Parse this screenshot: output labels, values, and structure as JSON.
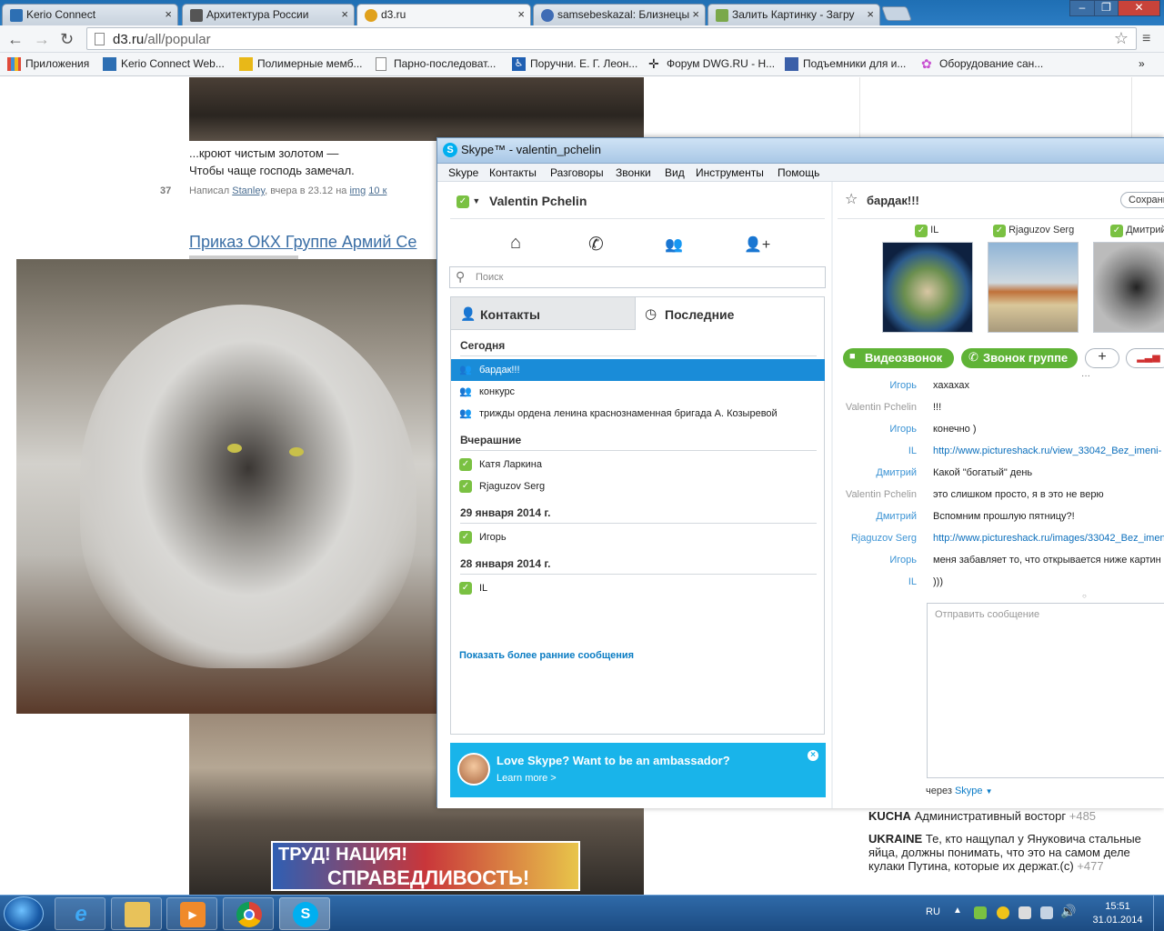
{
  "browser": {
    "tabs": [
      {
        "label": "Kerio Connect",
        "color": "#2d6fb3"
      },
      {
        "label": "Архитектура России",
        "color": "#555555"
      },
      {
        "label": "d3.ru",
        "color": "#e0a11c"
      },
      {
        "label": "samsebeskazal: Близнецы",
        "color": "#3f6cb5"
      },
      {
        "label": "Залить Картинку - Загру",
        "color": "#7aa84a"
      }
    ],
    "url_host": "d3.ru",
    "url_path": "/all/popular",
    "bookmarks": [
      {
        "label": "Приложения",
        "color": "#e04a3a"
      },
      {
        "label": "Kerio Connect Web...",
        "color": "#2d6fb3"
      },
      {
        "label": "Полимерные мемб...",
        "color": "#e8b818"
      },
      {
        "label": "Парно-последоват...",
        "color": "#dddddd"
      },
      {
        "label": "Поручни. Е. Г. Леон...",
        "color": "#1f5fb2"
      },
      {
        "label": "Форум DWG.RU - Н...",
        "color": "#333333"
      },
      {
        "label": "Подъемники для и...",
        "color": "#3a5fa8"
      },
      {
        "label": "Оборудование сан...",
        "color": "#c84fd1"
      }
    ]
  },
  "page": {
    "poem_line1": "...кроют чистым золотом —",
    "poem_line2": "Чтобы чаще господь замечал.",
    "rating": "37",
    "byline_prefix": "Написал",
    "byline_author": "Stanley",
    "byline_time": ", вчера в 23.12 на",
    "byline_site": "img",
    "byline_comments": "10 к",
    "post_title": "Приказ ОКХ Группе Армий Се",
    "banner_text_1": "ТРУД! НАЦИЯ!",
    "banner_text_2": "СПРАВЕДЛИВОСТЬ!",
    "sidebar": [
      {
        "site": "KUCHA",
        "text": "Административный восторг",
        "count": "+485"
      },
      {
        "site": "UKRAINE",
        "text": "Те, кто нащупал у Януковича стальные яйца, должны понимать, что это на самом деле кулаки Путина, которые их держат.(с)",
        "count": "+477"
      }
    ]
  },
  "skype": {
    "title": "Skype™ - valentin_pchelin",
    "menu": [
      "Skype",
      "Контакты",
      "Разговоры",
      "Звонки",
      "Вид",
      "Инструменты",
      "Помощь"
    ],
    "profile_name": "Valentin Pchelin",
    "search_placeholder": "Поиск",
    "tab_contacts": "Контакты",
    "tab_recent": "Последние",
    "groups": [
      {
        "heading": "Сегодня",
        "items": [
          {
            "label": "бардак!!!",
            "kind": "group",
            "selected": true
          },
          {
            "label": "конкурс",
            "kind": "group",
            "selected": false
          },
          {
            "label": "трижды ордена ленина краснознаменная бригада А. Козыревой",
            "kind": "group",
            "selected": false
          }
        ]
      },
      {
        "heading": "Вчерашние",
        "items": [
          {
            "label": "Катя Ларкина",
            "kind": "contact",
            "selected": false
          },
          {
            "label": "Rjaguzov Serg",
            "kind": "contact",
            "selected": false
          }
        ]
      },
      {
        "heading": "29 января 2014 г.",
        "items": [
          {
            "label": "Игорь",
            "kind": "contact",
            "selected": false
          }
        ]
      },
      {
        "heading": "28 января 2014 г.",
        "items": [
          {
            "label": "IL",
            "kind": "contact",
            "selected": false
          }
        ]
      }
    ],
    "show_earlier": "Показать более ранние сообщения",
    "ambassador_title": "Love Skype? Want to be an ambassador?",
    "ambassador_link": "Learn more >",
    "chat_title": "бардак!!!",
    "save_label": "Сохрани",
    "participants": [
      "IL",
      "Rjaguzov Serg",
      "Дмитрий"
    ],
    "video_call": "Видеозвонок",
    "group_call": "Звонок группе",
    "add_symbol": "+",
    "more_dots": "···",
    "messages": [
      {
        "author": "Игорь",
        "text": "хахахах",
        "me": false,
        "link": false
      },
      {
        "author": "Valentin Pchelin",
        "text": "!!!",
        "me": true,
        "link": false
      },
      {
        "author": "Игорь",
        "text": "конечно )",
        "me": false,
        "link": false
      },
      {
        "author": "IL",
        "text": "http://www.pictureshack.ru/view_33042_Bez_imeni-",
        "me": false,
        "link": true
      },
      {
        "author": "Дмитрий",
        "text": "Какой \"богатый\" день",
        "me": false,
        "link": false
      },
      {
        "author": "Valentin Pchelin",
        "text": "это слишком просто, я в это не верю",
        "me": true,
        "link": false
      },
      {
        "author": "Дмитрий",
        "text": "Вспомним прошлую пятницу?!",
        "me": false,
        "link": false
      },
      {
        "author": "Rjaguzov Serg",
        "text": "http://www.pictureshack.ru/images/33042_Bez_imen",
        "me": false,
        "link": true
      },
      {
        "author": "Игорь",
        "text": "меня забавляет то, что открывается ниже картин",
        "me": false,
        "link": false
      },
      {
        "author": "IL",
        "text": ")))",
        "me": false,
        "link": false
      }
    ],
    "message_placeholder": "Отправить сообщение",
    "via_prefix": "через",
    "via_service": "Skype"
  },
  "taskbar": {
    "lang": "RU",
    "time": "15:51",
    "date": "31.01.2014"
  }
}
